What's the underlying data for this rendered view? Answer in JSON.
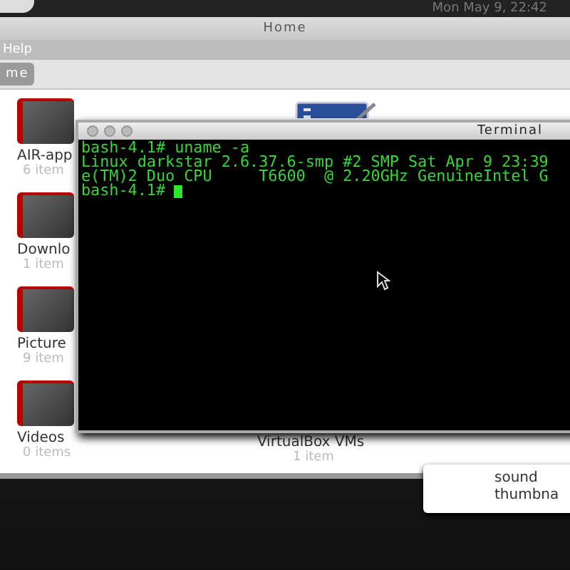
{
  "top_panel": {
    "clock": "Mon May  9, 22:42"
  },
  "file_manager": {
    "title": "Home",
    "menu": [
      "Help"
    ],
    "location": "me",
    "items": [
      {
        "kind": "folder",
        "name": "AIR-app",
        "count": "6 item"
      },
      {
        "kind": "folder",
        "name": "Downlo",
        "count": "1 item"
      },
      {
        "kind": "folder",
        "name": "Picture",
        "count": "9 item"
      },
      {
        "kind": "folder",
        "name": "Videos",
        "count": "0 items"
      },
      {
        "kind": "document"
      },
      {
        "kind": "folder-hidden",
        "name": "VirtualBox VMs",
        "count": "1 item"
      }
    ]
  },
  "terminal": {
    "title": "Terminal",
    "lines": [
      "bash-4.1# uname -a",
      "Linux darkstar 2.6.37.6-smp #2 SMP Sat Apr 9 23:39",
      "e(TM)2 Duo CPU     T6600  @ 2.20GHz GenuineIntel G"
    ],
    "prompt": "bash-4.1#"
  },
  "popup_list": {
    "items": [
      "sound",
      "thumbna"
    ]
  }
}
